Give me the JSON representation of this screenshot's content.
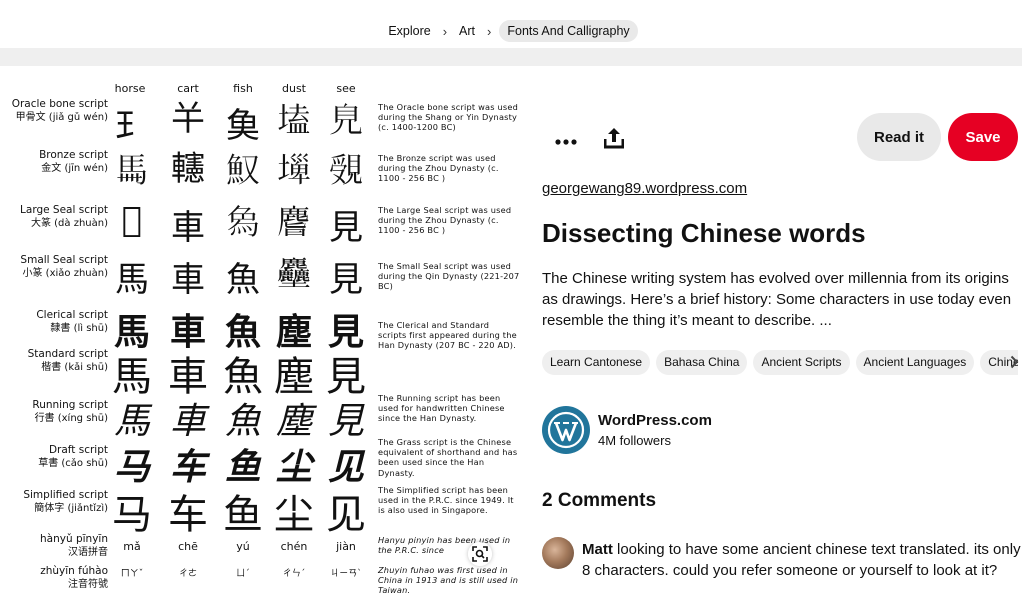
{
  "breadcrumb": {
    "items": [
      "Explore",
      "Art",
      "Fonts And Calligraphy"
    ]
  },
  "pin_image": {
    "columns": [
      "horse",
      "cart",
      "fish",
      "dust",
      "see"
    ],
    "rows": [
      {
        "label": "Oracle bone script",
        "label_cn": "甲骨文 (jiǎ gǔ wén)",
        "glyphs": [
          "𤣩",
          "𢆉",
          "𩵋",
          "𡏖",
          "𧠆"
        ],
        "desc": "The Oracle bone script was used during the Shang or Yin Dynasty (c. 1400-1200 BC)"
      },
      {
        "label": "Bronze script",
        "label_cn": "金文 (jīn wén)",
        "glyphs": [
          "𩡧",
          "𨏥",
          "𩵎",
          "𡐕",
          "𧡓"
        ],
        "desc": "The Bronze script was used during the Zhou Dynasty (c. 1100 - 256 BC )"
      },
      {
        "label": "Large Seal script",
        "label_cn": "大篆 (dà zhuàn)",
        "glyphs": [
          "𢒅",
          "車",
          "𤉢",
          "𪊨",
          "見"
        ],
        "desc": "The Large Seal script was used during the Zhou Dynasty (c. 1100 - 256 BC )"
      },
      {
        "label": "Small Seal script",
        "label_cn": "小篆 (xiǎo zhuàn)",
        "glyphs": [
          "馬",
          "車",
          "魚",
          "𪋻",
          "見"
        ],
        "desc": "The Small Seal script was used during the Qin Dynasty (221-207 BC)"
      },
      {
        "label": "Clerical script",
        "label_cn": "隸書 (lì shū)",
        "glyphs": [
          "馬",
          "車",
          "魚",
          "塵",
          "見"
        ],
        "desc": "The Clerical and Standard scripts first appeared during the Han Dynasty (207 BC - 220 AD)."
      },
      {
        "label": "Standard script",
        "label_cn": "楷書 (kǎi shū)",
        "glyphs": [
          "馬",
          "車",
          "魚",
          "塵",
          "見"
        ],
        "desc": ""
      },
      {
        "label": "Running script",
        "label_cn": "行書 (xíng shū)",
        "glyphs": [
          "馬",
          "車",
          "魚",
          "塵",
          "見"
        ],
        "desc": "The Running script has been used for handwritten Chinese since the Han Dynasty."
      },
      {
        "label": "Draft script",
        "label_cn": "草書 (cǎo shū)",
        "glyphs": [
          "马",
          "车",
          "鱼",
          "尘",
          "见"
        ],
        "desc": "The Grass script is the Chinese equivalent of shorthand and has been used since the Han Dynasty."
      },
      {
        "label": "Simplified script",
        "label_cn": "簡体字 (jiǎntǐzì)",
        "glyphs": [
          "马",
          "车",
          "鱼",
          "尘",
          "见"
        ],
        "desc": "The Simplified script has been used in the P.R.C. since 1949. It is also used in Singapore."
      },
      {
        "label": "hànyǔ pīnyīn",
        "label_cn": "汉语拼音",
        "glyphs": [
          "mǎ",
          "chē",
          "yú",
          "chén",
          "jiàn"
        ],
        "desc": "Hanyu pinyin has been used in the P.R.C. since"
      },
      {
        "label": "zhùyīn fúhào",
        "label_cn": "注音符號",
        "glyphs": [
          "ㄇㄚˇ",
          "ㄔㄜ",
          "ㄩˊ",
          "ㄔㄣˊ",
          "ㄐㄧㄢˋ"
        ],
        "desc": "Zhuyin fuhao was first used in China in 1913 and is still used in Taiwan."
      }
    ]
  },
  "actions": {
    "more_icon": "ellipsis-icon",
    "share_icon": "share-upload-icon",
    "read_label": "Read it",
    "save_label": "Save"
  },
  "pin": {
    "source": "georgewang89.wordpress.com",
    "title": "Dissecting Chinese words",
    "description": "The Chinese writing system has evolved over millennia from its origins as drawings. Here’s a brief history: Some characters in use today even resemble the thing it’s meant to describe. ...",
    "tags": [
      "Learn Cantonese",
      "Bahasa China",
      "Ancient Scripts",
      "Ancient Languages",
      "Chinese"
    ]
  },
  "creator": {
    "name": "WordPress.com",
    "followers": "4M followers"
  },
  "comments": {
    "header": "2 Comments",
    "first": {
      "author": "Matt",
      "text": "looking to have some ancient chinese text translated. its only 8 characters. could you refer someone or yourself to look at it?"
    }
  },
  "colors": {
    "save": "#e60023",
    "chip": "#efefef",
    "wordpress": "#21759b"
  }
}
